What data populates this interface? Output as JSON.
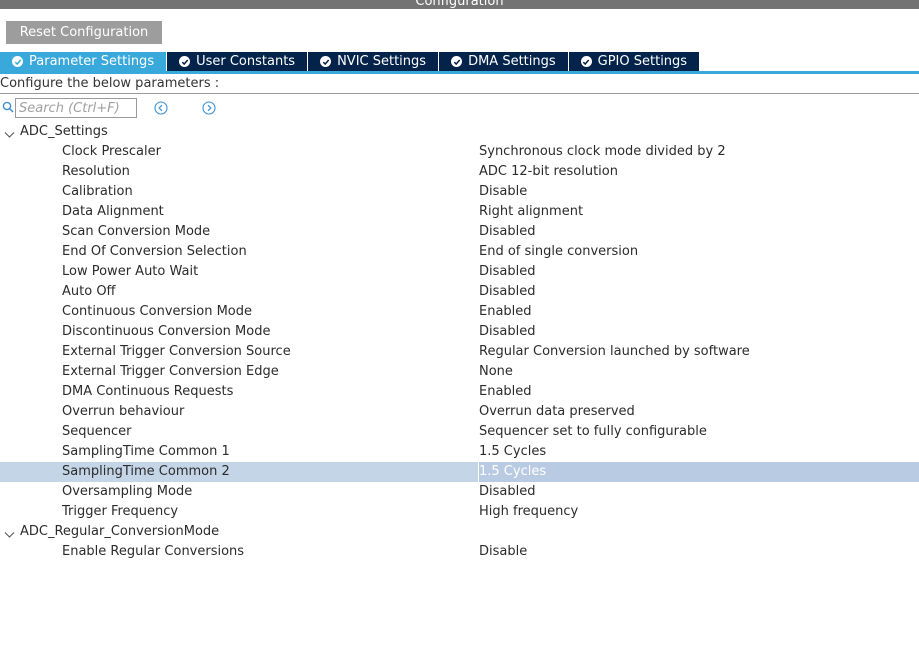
{
  "window": {
    "title": "Configuration"
  },
  "toolbar": {
    "reset_label": "Reset Configuration"
  },
  "tabs": [
    {
      "label": "Parameter Settings",
      "active": true
    },
    {
      "label": "User Constants",
      "active": false
    },
    {
      "label": "NVIC Settings",
      "active": false
    },
    {
      "label": "DMA Settings",
      "active": false
    },
    {
      "label": "GPIO Settings",
      "active": false
    }
  ],
  "configure_label": "Configure the below parameters :",
  "search": {
    "placeholder": "Search (Ctrl+F)",
    "value": ""
  },
  "icons": {
    "search": "search-icon",
    "prev": "arrow-left-circle-icon",
    "next": "arrow-right-circle-icon",
    "expand": "chevron-down-icon",
    "tab_check": "check-circle-icon"
  },
  "colors": {
    "tab_active": "#39a9dc",
    "tab_inactive": "#03234b",
    "selected_row": "#c5d5e8",
    "reset_button": "#9d9d9d"
  },
  "groups": [
    {
      "name": "ADC_Settings",
      "params": [
        {
          "name": "Clock Prescaler",
          "value": "Synchronous clock mode divided by 2"
        },
        {
          "name": "Resolution",
          "value": "ADC 12-bit resolution"
        },
        {
          "name": "Calibration",
          "value": "Disable"
        },
        {
          "name": "Data Alignment",
          "value": "Right alignment"
        },
        {
          "name": "Scan Conversion Mode",
          "value": "Disabled"
        },
        {
          "name": "End Of Conversion Selection",
          "value": "End of single conversion"
        },
        {
          "name": "Low Power Auto Wait",
          "value": "Disabled"
        },
        {
          "name": "Auto Off",
          "value": "Disabled"
        },
        {
          "name": "Continuous Conversion Mode",
          "value": "Enabled"
        },
        {
          "name": "Discontinuous Conversion Mode",
          "value": "Disabled"
        },
        {
          "name": "External Trigger Conversion Source",
          "value": "Regular Conversion launched by software"
        },
        {
          "name": "External Trigger Conversion Edge",
          "value": "None"
        },
        {
          "name": "DMA Continuous Requests",
          "value": "Enabled"
        },
        {
          "name": "Overrun behaviour",
          "value": "Overrun data preserved"
        },
        {
          "name": "Sequencer",
          "value": "Sequencer set to fully configurable"
        },
        {
          "name": "SamplingTime Common 1",
          "value": "1.5 Cycles"
        },
        {
          "name": "SamplingTime Common 2",
          "value": "1.5 Cycles",
          "selected": true
        },
        {
          "name": "Oversampling Mode",
          "value": "Disabled"
        },
        {
          "name": "Trigger Frequency",
          "value": "High frequency"
        }
      ]
    },
    {
      "name": "ADC_Regular_ConversionMode",
      "params": [
        {
          "name": "Enable Regular Conversions",
          "value": "Disable"
        }
      ]
    }
  ]
}
